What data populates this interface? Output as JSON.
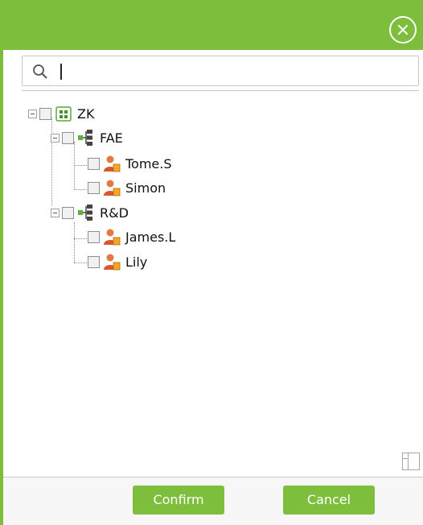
{
  "header": {
    "close_icon": "close-circle-icon",
    "accent_color": "#7dbe3c"
  },
  "search": {
    "icon": "search-icon",
    "value": "",
    "placeholder": ""
  },
  "tree": {
    "root": {
      "label": "ZK",
      "icon": "building-icon",
      "checked": false,
      "expanded": true,
      "children": [
        {
          "label": "FAE",
          "icon": "department-icon",
          "checked": false,
          "expanded": true,
          "children": [
            {
              "label": "Tome.S",
              "icon": "user-icon",
              "checked": false
            },
            {
              "label": "Simon",
              "icon": "user-icon",
              "checked": false
            }
          ]
        },
        {
          "label": "R&D",
          "icon": "department-icon",
          "checked": false,
          "expanded": true,
          "children": [
            {
              "label": "James.L",
              "icon": "user-icon",
              "checked": false
            },
            {
              "label": "Lily",
              "icon": "user-icon",
              "checked": false
            }
          ]
        }
      ]
    }
  },
  "layout_toggle": {
    "icon": "panel-layout-icon"
  },
  "footer": {
    "confirm_label": "Confirm",
    "cancel_label": "Cancel"
  }
}
